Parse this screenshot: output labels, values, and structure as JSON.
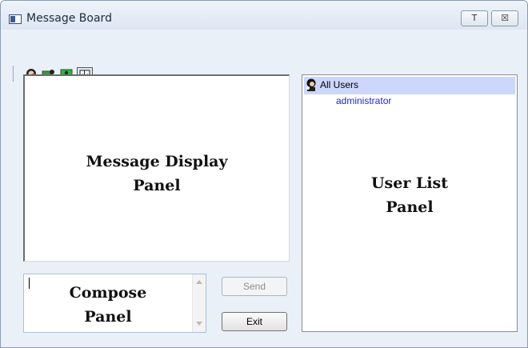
{
  "window": {
    "title": "Message Board",
    "buttons": [
      "T",
      "☒"
    ]
  },
  "toolbar": {
    "icons": [
      "user-status-icon",
      "network-user-icon",
      "monitor-icon",
      "panel-toggle-icon"
    ]
  },
  "message_display": {
    "label_line1": "Message Display",
    "label_line2": "Panel"
  },
  "user_list": {
    "label_line1": "User List",
    "label_line2": "Panel",
    "group_label": "All Users",
    "users": [
      "administrator"
    ],
    "selection_color": "#cdd6fb",
    "user_color": "#2323e6"
  },
  "compose": {
    "label_line1": "Compose",
    "label_line2": "Panel",
    "value": ""
  },
  "buttons": {
    "send": "Send",
    "exit": "Exit"
  }
}
